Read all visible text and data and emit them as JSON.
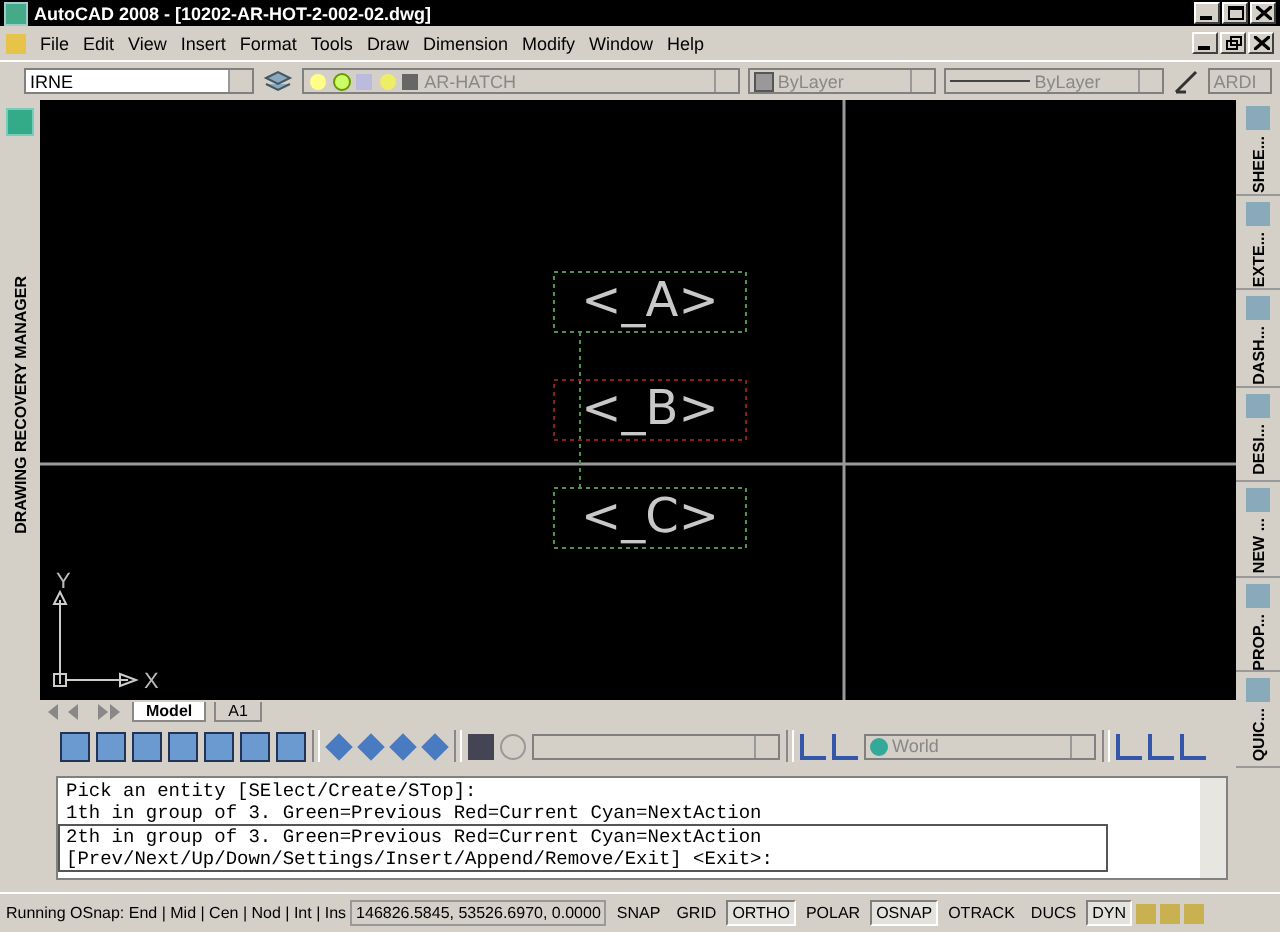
{
  "window": {
    "title": "AutoCAD 2008 - [10202-AR-HOT-2-002-02.dwg]"
  },
  "menu": [
    "File",
    "Edit",
    "View",
    "Insert",
    "Format",
    "Tools",
    "Draw",
    "Dimension",
    "Modify",
    "Window",
    "Help"
  ],
  "properties_toolbar": {
    "workspace": "IRNE",
    "layer": "AR-HATCH",
    "color_setting": "ByLayer",
    "linetype": "ByLayer",
    "style": "ARDI"
  },
  "side_panel": {
    "title": "DRAWING RECOVERY MANAGER"
  },
  "canvas": {
    "entities": [
      {
        "label": "<_A>",
        "color": "#4f8f4f"
      },
      {
        "label": "<_B>",
        "color": "#8a1e1e"
      },
      {
        "label": "<_C>",
        "color": "#4f8f4f"
      }
    ],
    "ucs": {
      "x_label": "X",
      "y_label": "Y"
    }
  },
  "layout_tabs": [
    {
      "label": "Model",
      "selected": true
    },
    {
      "label": "A1",
      "selected": false
    }
  ],
  "ucs_toolbar": {
    "ucs": "World"
  },
  "palette_tabs": [
    "SHEE...",
    "EXTE...",
    "DASH...",
    "DESI...",
    "NEW ...",
    "PROP...",
    "QUIC..."
  ],
  "command_history": [
    "Pick an entity [SElect/Create/STop]:",
    "1th in group of 3. Green=Previous Red=Current Cyan=NextAction"
  ],
  "command_prompt": [
    "2th in group of 3. Green=Previous Red=Current Cyan=NextAction",
    "[Prev/Next/Up/Down/Settings/Insert/Append/Remove/Exit] <Exit>:"
  ],
  "status_bar": {
    "osnap": "Running OSnap: End | Mid | Cen | Nod | Int | Ins",
    "coordinates": "146826.5845, 53526.6970, 0.0000",
    "toggles": [
      {
        "label": "SNAP",
        "on": false
      },
      {
        "label": "GRID",
        "on": false
      },
      {
        "label": "ORTHO",
        "on": true
      },
      {
        "label": "POLAR",
        "on": false
      },
      {
        "label": "OSNAP",
        "on": true
      },
      {
        "label": "OTRACK",
        "on": false
      },
      {
        "label": "DUCS",
        "on": false
      },
      {
        "label": "DYN",
        "on": true
      }
    ]
  }
}
